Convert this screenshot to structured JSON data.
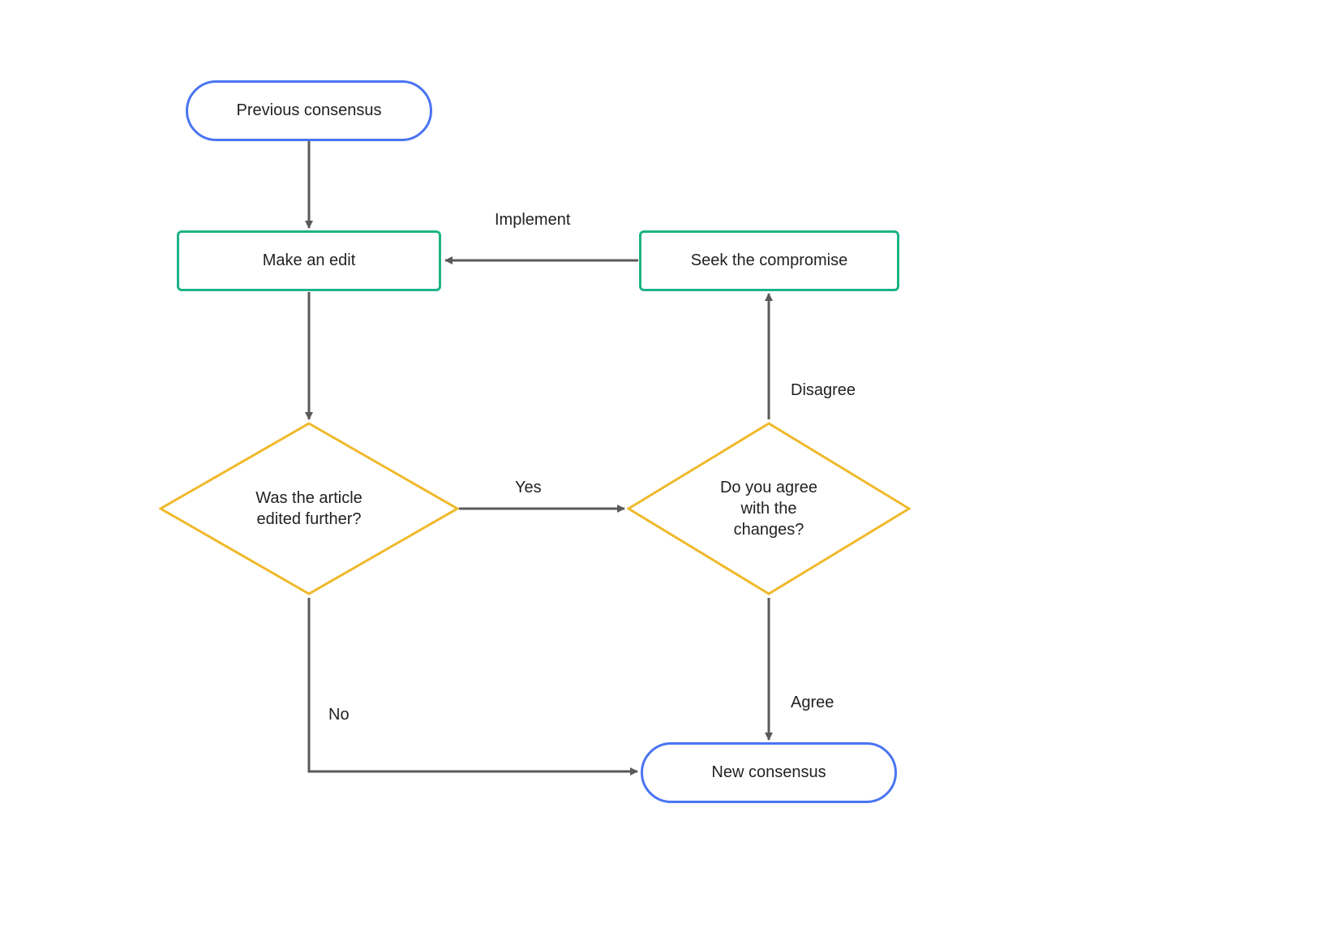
{
  "nodes": {
    "previous_consensus": {
      "label": "Previous consensus"
    },
    "make_edit": {
      "label": "Make an edit"
    },
    "seek_compromise": {
      "label": "Seek the compromise"
    },
    "was_edited": {
      "label": "Was the article\nedited further?"
    },
    "agree_changes": {
      "label": "Do you agree\nwith the\nchanges?"
    },
    "new_consensus": {
      "label": "New consensus"
    }
  },
  "edges": {
    "implement": "Implement",
    "yes": "Yes",
    "no": "No",
    "disagree": "Disagree",
    "agree": "Agree"
  },
  "colors": {
    "terminator": "#4a74f2",
    "process": "#1db386",
    "decision": "#f0b92b",
    "arrow": "#5a5a5a"
  }
}
